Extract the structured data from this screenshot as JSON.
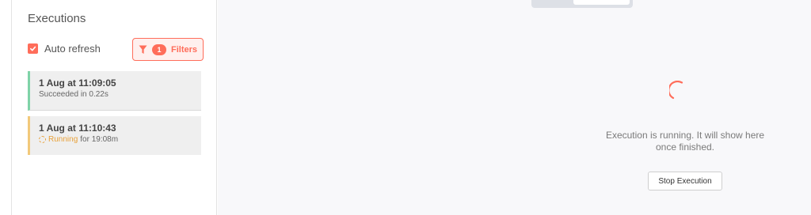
{
  "colors": {
    "accent": "#ff6d5a",
    "accent_bg": "#fff0ee",
    "success": "#7fd3a8",
    "warning": "#f2c97a",
    "running": "#e8a13a"
  },
  "sidebar": {
    "title": "Executions",
    "auto_refresh": {
      "label": "Auto refresh",
      "checked": true
    },
    "filters": {
      "label": "Filters",
      "count": "1",
      "icon": "filter-icon"
    },
    "executions": [
      {
        "date": "1 Aug at 11:09:05",
        "status_text": "Succeeded in 0.22s",
        "state": "success"
      },
      {
        "date": "1 Aug at 11:10:43",
        "status_label": "Running",
        "status_suffix": "for 19:08m",
        "state": "running"
      }
    ]
  },
  "main": {
    "message": "Execution is running. It will show here once finished.",
    "stop_button_label": "Stop Execution"
  }
}
